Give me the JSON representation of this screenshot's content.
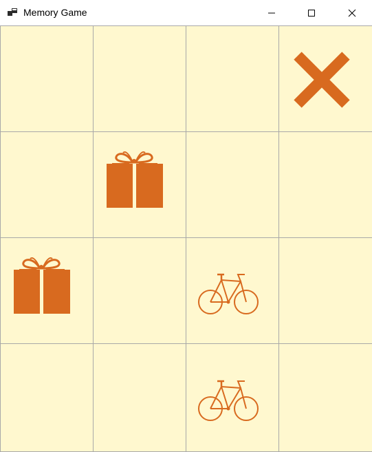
{
  "window": {
    "title": "Memory Game",
    "icon": "app-window-icon",
    "controls": [
      "minimize-icon",
      "maximize-icon",
      "close-icon"
    ]
  },
  "board": {
    "rows": 4,
    "columns": 4,
    "cell_color": "#fff8cf",
    "line_color": "#a8a8a8",
    "icon_color": "#d86a1f",
    "cells": [
      [
        null,
        null,
        null,
        "x-mark"
      ],
      [
        null,
        "gift",
        null,
        null
      ],
      [
        "gift",
        null,
        "bicycle",
        null
      ],
      [
        null,
        null,
        "bicycle",
        null
      ]
    ]
  }
}
